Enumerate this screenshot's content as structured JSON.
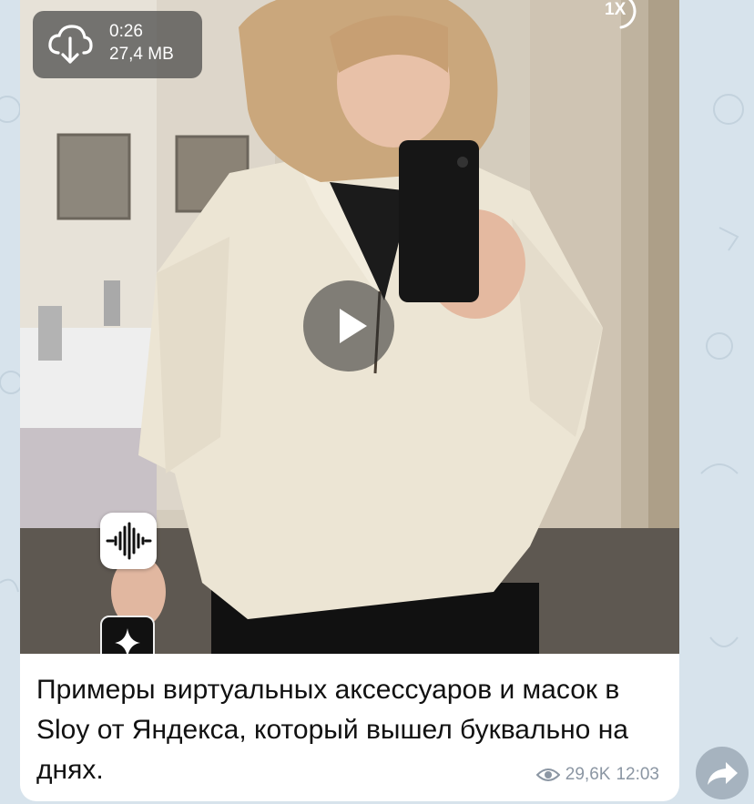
{
  "video": {
    "duration": "0:26",
    "size": "27,4 MB",
    "speed": "1X"
  },
  "icons": {
    "download": "cloud-download-icon",
    "play": "play-icon",
    "audio_app": "waveform-icon",
    "sparkle_app": "sparkle-icon",
    "views": "eye-icon",
    "share": "share-arrow-icon"
  },
  "message": {
    "caption": "Примеры виртуальных аксессуаров и масок в Sloy от Яндекса, который вышел буквально на днях.",
    "views": "29,6K",
    "time": "12:03"
  },
  "colors": {
    "background": "#d7e3ec",
    "bubble": "#ffffff",
    "meta_text": "#8b96a3",
    "overlay": "#464646"
  }
}
